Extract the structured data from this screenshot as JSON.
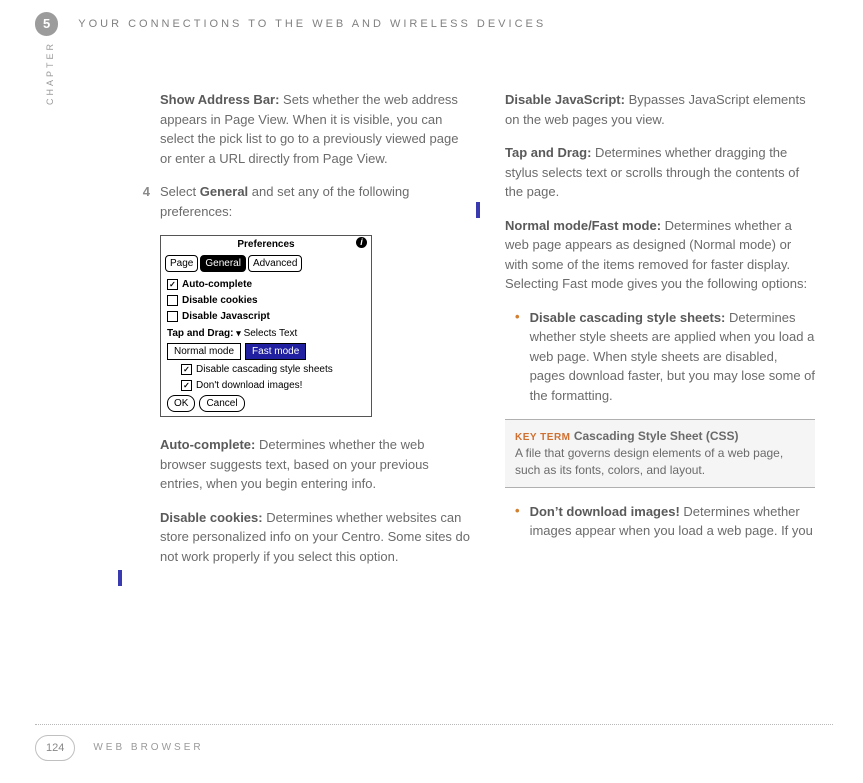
{
  "header": {
    "chapter_num": "5",
    "title": "YOUR CONNECTIONS TO THE WEB AND WIRELESS DEVICES",
    "chapter_label": "CHAPTER"
  },
  "left": {
    "p1": {
      "t": "Show Address Bar:",
      "b": " Sets whether the web address appears in Page View. When it is visible, you can select the pick list to go to a previously viewed page or enter a URL directly from Page View."
    },
    "step4": {
      "n": "4",
      "a": "Select ",
      "b": "General",
      "c": " and set any of the following preferences:"
    },
    "p2": {
      "t": "Auto-complete:",
      "b": " Determines whether the web browser suggests text, based on your previous entries, when you begin entering info."
    },
    "p3": {
      "t": "Disable cookies:",
      "b": " Determines whether websites can store personalized info on your Centro. Some sites do not work properly if you select this option."
    }
  },
  "right": {
    "p1": {
      "t": "Disable JavaScript:",
      "b": " Bypasses JavaScript elements on the web pages you view."
    },
    "p2": {
      "t": "Tap and Drag:",
      "b": " Determines whether dragging the stylus selects text or scrolls through the contents of the page."
    },
    "p3": {
      "t": "Normal mode/Fast mode:",
      "b": " Determines whether a web page appears as designed (Normal mode) or with some of the items removed for faster display. Selecting Fast mode gives you the following options:"
    },
    "b1": {
      "t": "Disable cascading style sheets:",
      "b": " Determines whether style sheets are applied when you load a web page. When style sheets are disabled, pages download faster, but you may lose some of the formatting."
    },
    "b2": {
      "t": "Don’t download images!",
      "b": " Determines whether images appear when you load a web page. If you"
    }
  },
  "keyterm": {
    "label": "KEY TERM",
    "title": " Cascading Style Sheet (CSS)",
    "body": "A file that governs design elements of a web page, such as its fonts, colors, and layout."
  },
  "prefs": {
    "title": "Preferences",
    "tabs": [
      "Page",
      "General",
      "Advanced"
    ],
    "rows": {
      "auto": "Auto-complete",
      "cook": "Disable cookies",
      "js": "Disable Javascript"
    },
    "td_label": "Tap and Drag:",
    "td_val": "Selects Text",
    "modes": [
      "Normal mode",
      "Fast mode"
    ],
    "sub1": "Disable cascading style sheets",
    "sub2": "Don't download images!",
    "ok": "OK",
    "cancel": "Cancel"
  },
  "footer": {
    "page": "124",
    "title": "WEB BROWSER"
  }
}
